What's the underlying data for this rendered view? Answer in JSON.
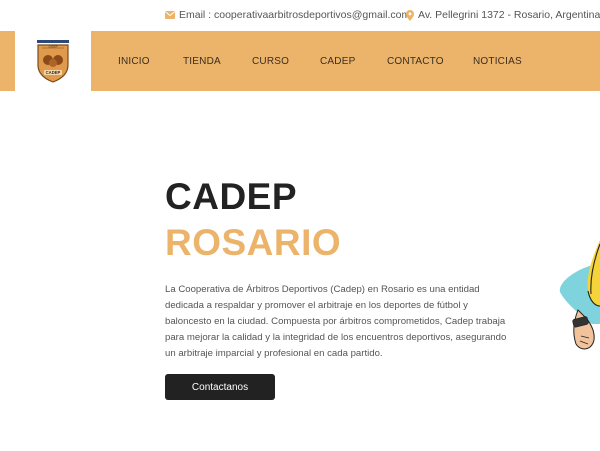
{
  "topbar": {
    "email_text": "Email : cooperativaarbitrosdeportivos@gmail.com",
    "address_text": "Av. Pellegrini 1372 - Rosario, Argentina"
  },
  "logo": {
    "arc_text": "CADEP",
    "label": "CADEP"
  },
  "nav": {
    "items": [
      "INICIO",
      "TIENDA",
      "CURSO",
      "CADEP",
      "CONTACTO",
      "NOTICIAS"
    ]
  },
  "hero": {
    "title_line1": "CADEP",
    "title_line2": "ROSARIO",
    "description": "La Cooperativa de Árbitros Deportivos (Cadep) en Rosario es una entidad dedicada a respaldar y promover el arbitraje en los deportes de fútbol y baloncesto en la ciudad. Compuesta por árbitros comprometidos, Cadep trabaja para mejorar la calidad y la integridad de los encuentros deportivos, asegurando un arbitraje imparcial y profesional en cada partido.",
    "cta_label": "Contactanos"
  },
  "colors": {
    "accent": "#ecb46a",
    "dark": "#222222",
    "text": "#555555"
  }
}
